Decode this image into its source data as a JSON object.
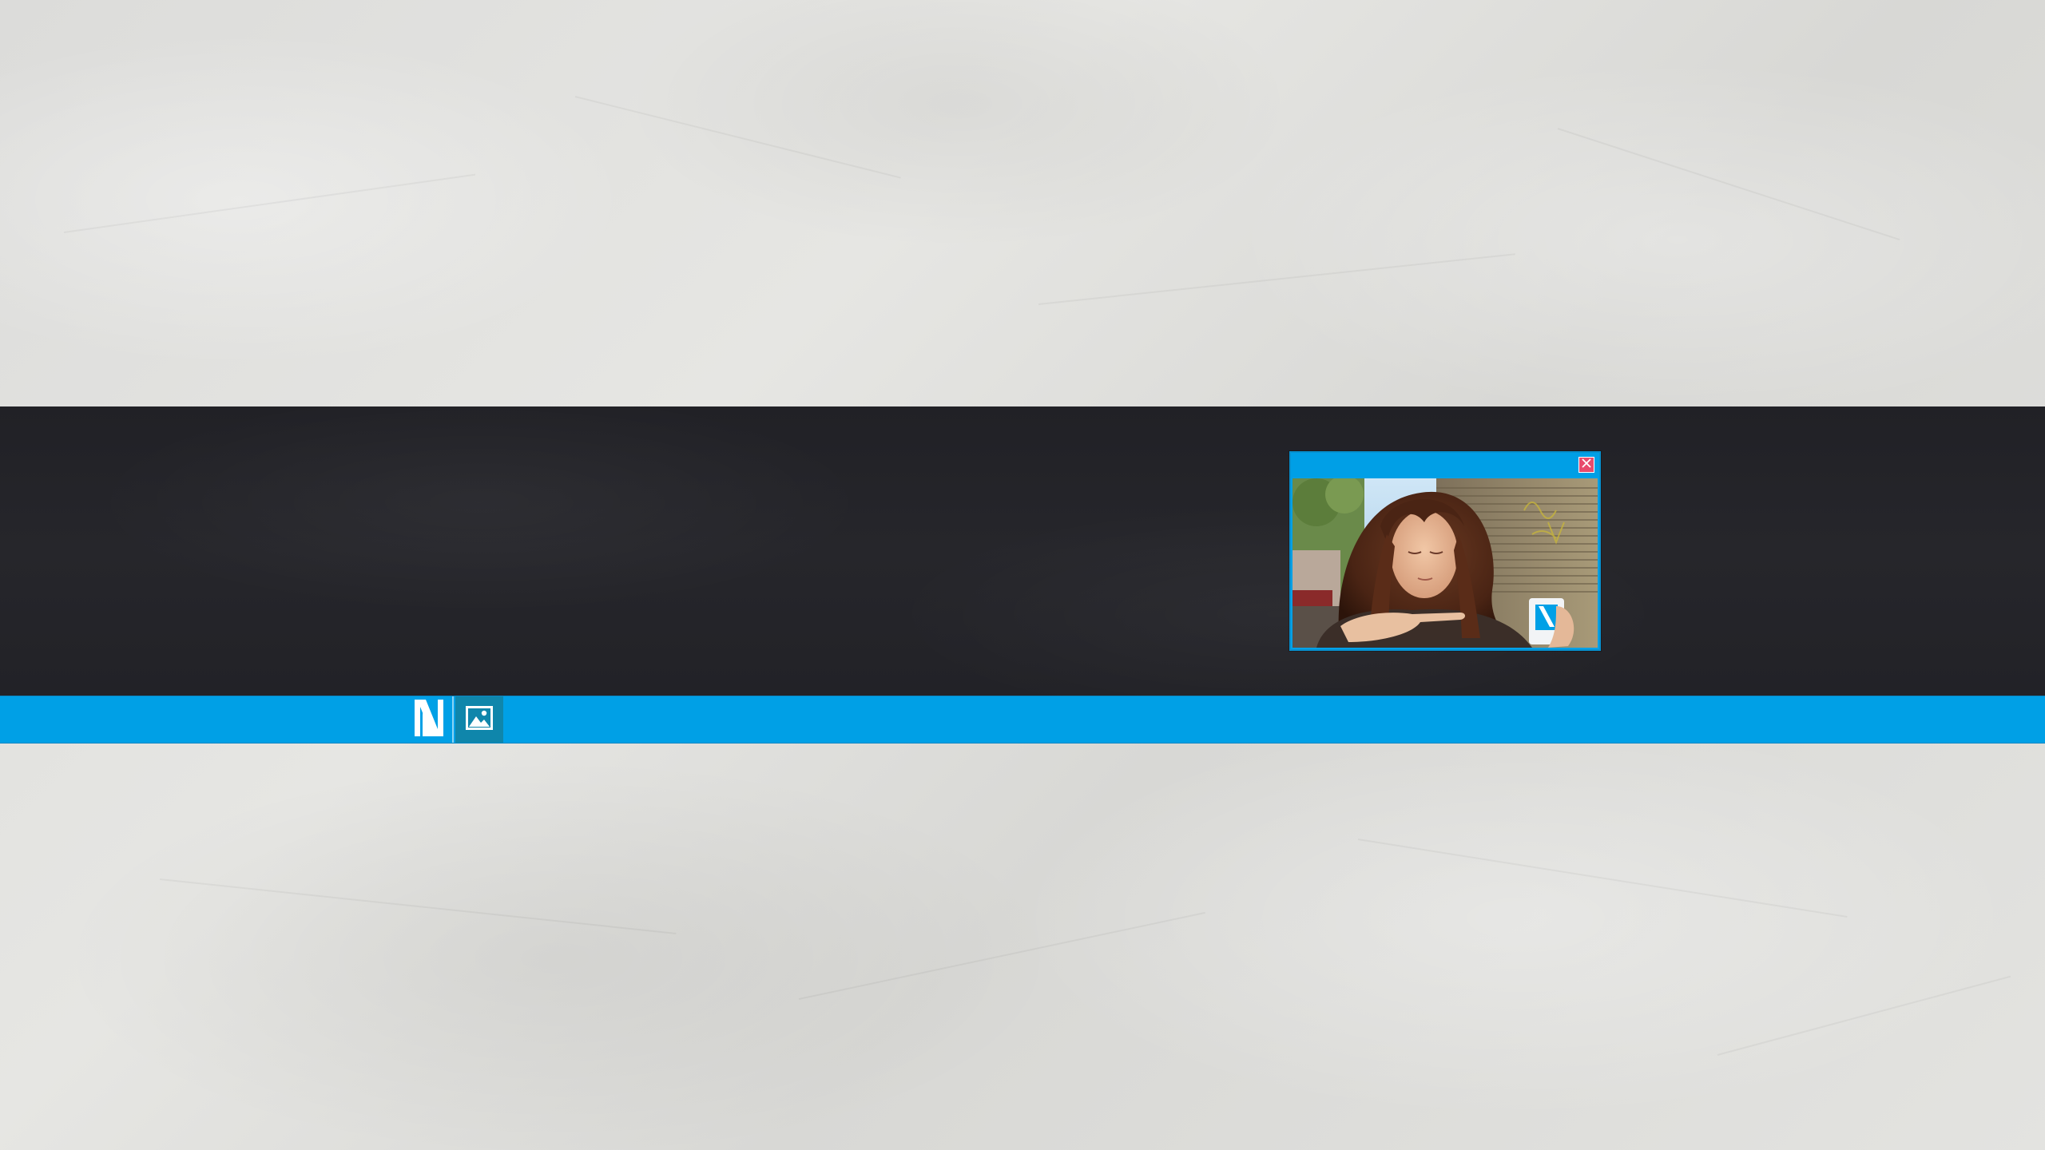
{
  "desktop": {
    "wallpaper": "crumpled-paper",
    "band_color": "#232328"
  },
  "taskbar": {
    "color": "#00a0e6",
    "items": [
      {
        "icon": "n-logo-icon",
        "active": false
      },
      {
        "icon": "image-viewer-icon",
        "active": true,
        "highlight_color": "#0f86ab"
      }
    ]
  },
  "image_window": {
    "title": "",
    "close_icon": "close-icon",
    "close_color": "#e84b6c",
    "content": "photo-of-person-with-mug"
  }
}
